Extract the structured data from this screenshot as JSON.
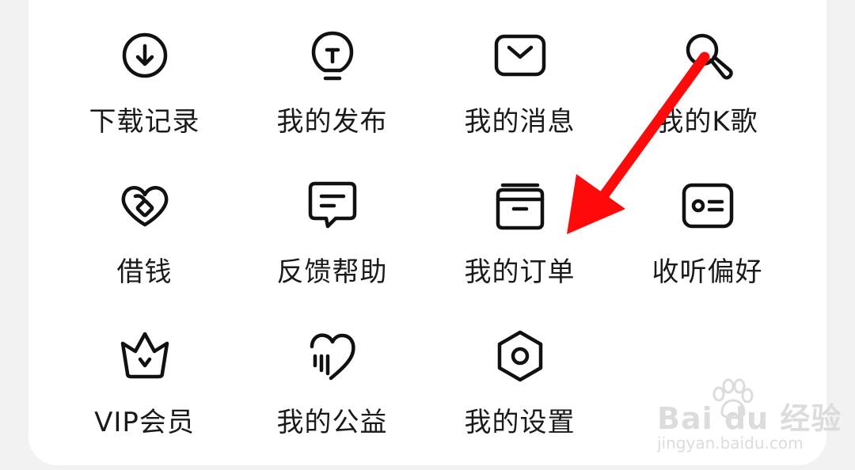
{
  "menu": {
    "items": [
      {
        "label": "下载记录",
        "icon": "download-icon"
      },
      {
        "label": "我的发布",
        "icon": "lightbulb-icon"
      },
      {
        "label": "我的消息",
        "icon": "envelope-icon"
      },
      {
        "label": "我的K歌",
        "icon": "microphone-icon"
      },
      {
        "label": "借钱",
        "icon": "coin-icon"
      },
      {
        "label": "反馈帮助",
        "icon": "chat-bubble-icon"
      },
      {
        "label": "我的订单",
        "icon": "folder-icon"
      },
      {
        "label": "收听偏好",
        "icon": "id-card-icon"
      },
      {
        "label": "VIP会员",
        "icon": "crown-icon"
      },
      {
        "label": "我的公益",
        "icon": "heart-icon"
      },
      {
        "label": "我的设置",
        "icon": "settings-icon"
      }
    ]
  },
  "annotation": {
    "arrow_color": "#ff0000",
    "target": "我的订单"
  },
  "watermark": {
    "brand": "Bai du 经验",
    "url": "jingyan.baidu.com"
  },
  "colors": {
    "background": "#f2f2f2",
    "card": "#ffffff",
    "text": "#1a1a1a",
    "icon_stroke": "#111111"
  }
}
